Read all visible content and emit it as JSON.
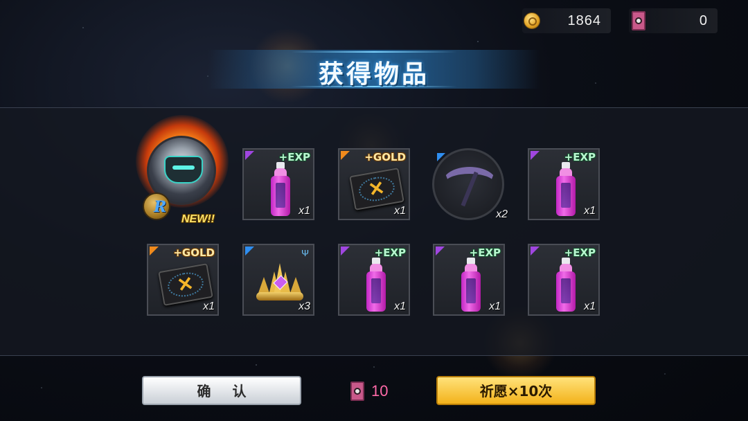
{
  "currency": {
    "gold": {
      "icon": "gold-coin-icon",
      "value": "1864"
    },
    "ticket": {
      "icon": "wish-ticket-icon",
      "value": "0"
    }
  },
  "title": "获得物品",
  "hero": {
    "rank": "R",
    "new_label": "NEW!!",
    "icon": "hero-portrait"
  },
  "items": [
    {
      "kind": "bottle",
      "rarity": "purple",
      "tag": "+EXP",
      "qty": "x1"
    },
    {
      "kind": "gold-ticket",
      "rarity": "orange",
      "tag": "+GOLD",
      "qty": "x1"
    },
    {
      "kind": "scythe",
      "rarity": "blue",
      "tag": "",
      "qty": "x2"
    },
    {
      "kind": "bottle",
      "rarity": "purple",
      "tag": "+EXP",
      "qty": "x1"
    },
    {
      "kind": "gold-ticket",
      "rarity": "orange",
      "tag": "+GOLD",
      "qty": "x1"
    },
    {
      "kind": "crown",
      "rarity": "blue",
      "tag": "",
      "qty": "x3"
    },
    {
      "kind": "bottle",
      "rarity": "purple",
      "tag": "+EXP",
      "qty": "x1"
    },
    {
      "kind": "bottle",
      "rarity": "purple",
      "tag": "+EXP",
      "qty": "x1"
    },
    {
      "kind": "bottle",
      "rarity": "purple",
      "tag": "+EXP",
      "qty": "x1"
    }
  ],
  "buttons": {
    "confirm": "确 认",
    "wish": "祈愿×10次"
  },
  "cost": {
    "icon": "wish-ticket-icon",
    "value": "10"
  },
  "colors": {
    "rarity_purple": "#a046e0",
    "rarity_orange": "#f08a1c",
    "rarity_blue": "#2f8ef0",
    "wish_button": "#f3b21b",
    "cost_text": "#ff6aa8"
  }
}
